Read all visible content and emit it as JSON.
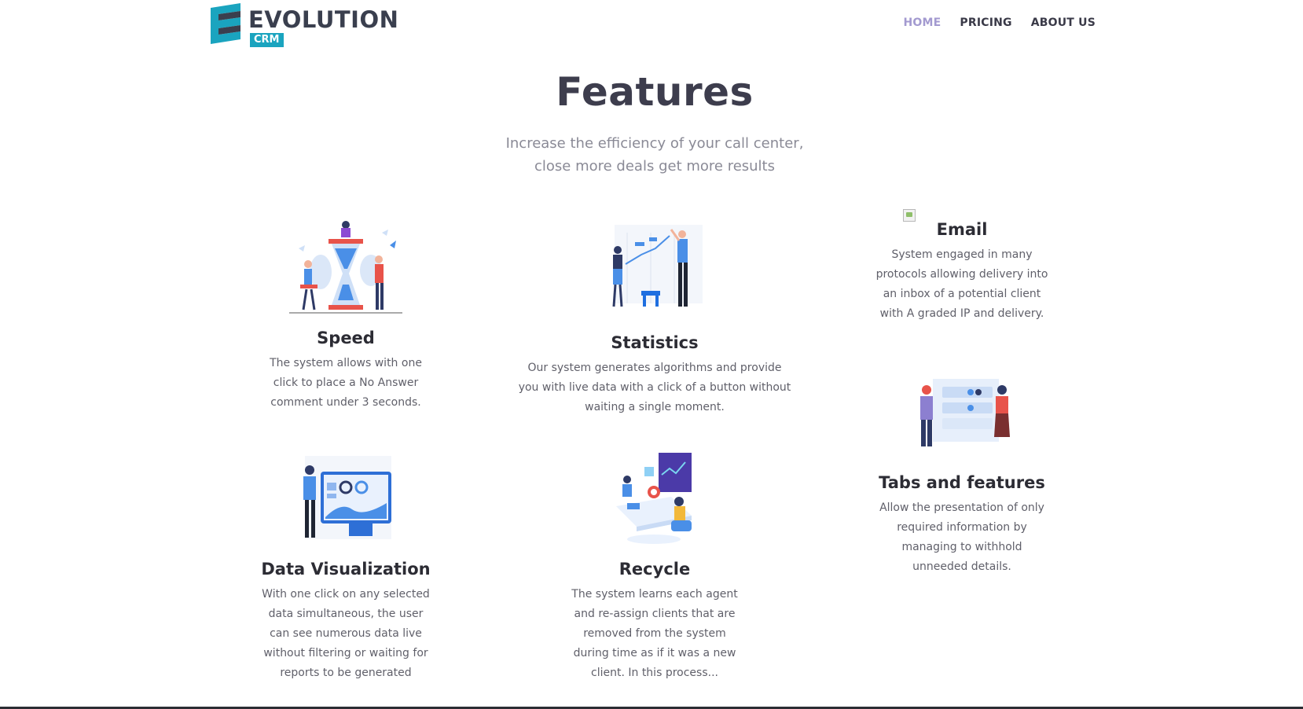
{
  "header": {
    "logo_word": "EVOLUTION",
    "logo_badge": "CRM",
    "nav": [
      {
        "label": "HOME",
        "active": true
      },
      {
        "label": "PRICING",
        "active": false
      },
      {
        "label": "ABOUT US",
        "active": false
      }
    ]
  },
  "hero": {
    "title": "Features",
    "subtitle_line1": "Increase the efficiency of your call center,",
    "subtitle_line2": "close more deals get more results"
  },
  "features": {
    "speed": {
      "title": "Speed",
      "lines": [
        "The system allows with one",
        "click to place a No Answer",
        "comment under 3 seconds."
      ],
      "icon": "hourglass-illustration"
    },
    "statistics": {
      "title": "Statistics",
      "lines": [
        "Our system generates algorithms and provide",
        "you with live data with a click of a button without",
        "waiting a single moment."
      ],
      "icon": "chart-presentation-illustration"
    },
    "email": {
      "title": "Email",
      "lines": [
        "System engaged in many",
        "protocols allowing delivery into",
        "an inbox of a potential client",
        "with A graded IP and delivery."
      ],
      "icon": "broken-image-icon"
    },
    "tabs": {
      "title": "Tabs and features",
      "lines": [
        "Allow the presentation of only",
        "required information by",
        "managing to withhold",
        "unneeded details."
      ],
      "icon": "profiles-illustration"
    },
    "dataviz": {
      "title": "Data Visualization",
      "lines": [
        "With one click on any selected",
        "data simultaneous, the user",
        "can see numerous data live",
        "without filtering or waiting for",
        "reports to be generated"
      ],
      "icon": "dashboard-illustration"
    },
    "recycle": {
      "title": "Recycle",
      "lines": [
        "The system learns each agent",
        "and re-assign clients that are",
        "removed from the system",
        "during time as if it was a new",
        "client. In this process..."
      ],
      "icon": "workstation-illustration"
    }
  },
  "colors": {
    "accent": "#1aa4bf",
    "nav_active": "#a39ad0",
    "title": "#3d3d4d",
    "illus_blue": "#4a8fe7",
    "illus_red": "#e8534a"
  }
}
